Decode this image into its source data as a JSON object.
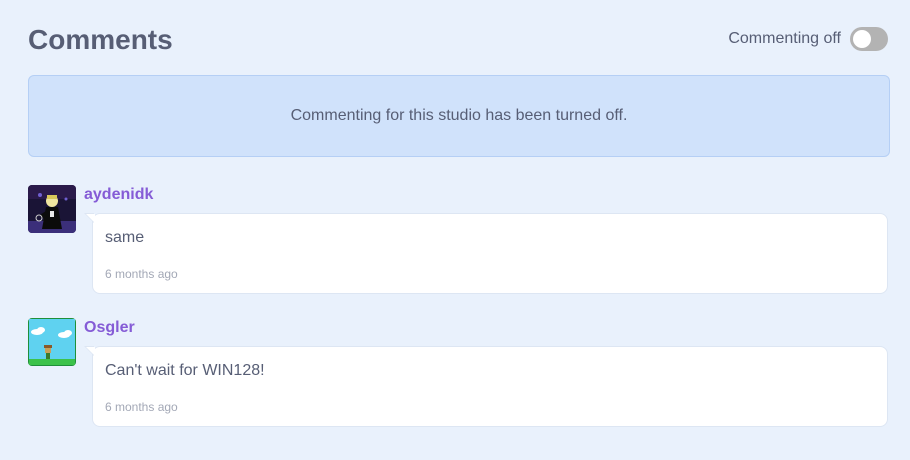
{
  "header": {
    "title": "Comments",
    "toggle_label": "Commenting off",
    "toggle_on": false
  },
  "notice": {
    "text": "Commenting for this studio has been turned off."
  },
  "comments": [
    {
      "username": "aydenidk",
      "text": "same",
      "time": "6 months ago",
      "avatar": "dark-character-avatar"
    },
    {
      "username": "Osgler",
      "text": "Can't wait for WIN128!",
      "time": "6 months ago",
      "avatar": "sky-scene-avatar"
    }
  ],
  "colors": {
    "background": "#e9f1fc",
    "notice_background": "#d0e2fb",
    "username": "#855cd6",
    "text": "#575e75",
    "toggle_off": "#b3b3b3"
  }
}
